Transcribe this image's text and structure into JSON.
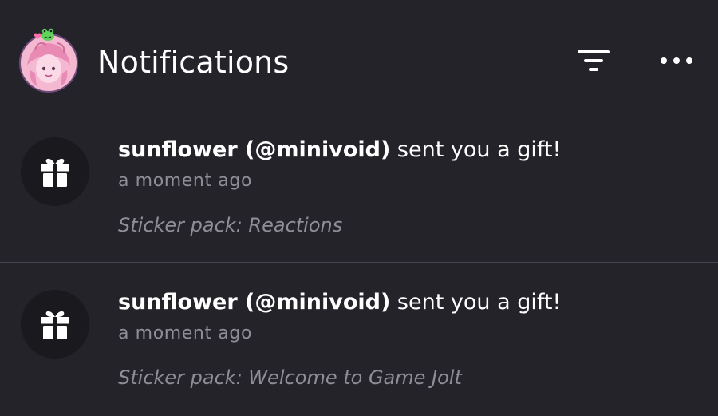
{
  "header": {
    "title": "Notifications",
    "avatar_icon": "user-avatar",
    "filter_icon": "filter-icon",
    "more_icon": "more-horizontal-icon"
  },
  "colors": {
    "background": "#25232a",
    "icon_circle": "#1a191e",
    "muted_text": "#8f8d96",
    "divider": "#45434b",
    "avatar_pink": "#f2a6c6"
  },
  "notifications": [
    {
      "icon": "gift-icon",
      "actor": "sunflower (@minivoid)",
      "action": " sent you a gift!",
      "time": "a moment ago",
      "detail": "Sticker pack: Reactions"
    },
    {
      "icon": "gift-icon",
      "actor": "sunflower (@minivoid)",
      "action": " sent you a gift!",
      "time": "a moment ago",
      "detail": "Sticker pack: Welcome to Game Jolt"
    }
  ]
}
